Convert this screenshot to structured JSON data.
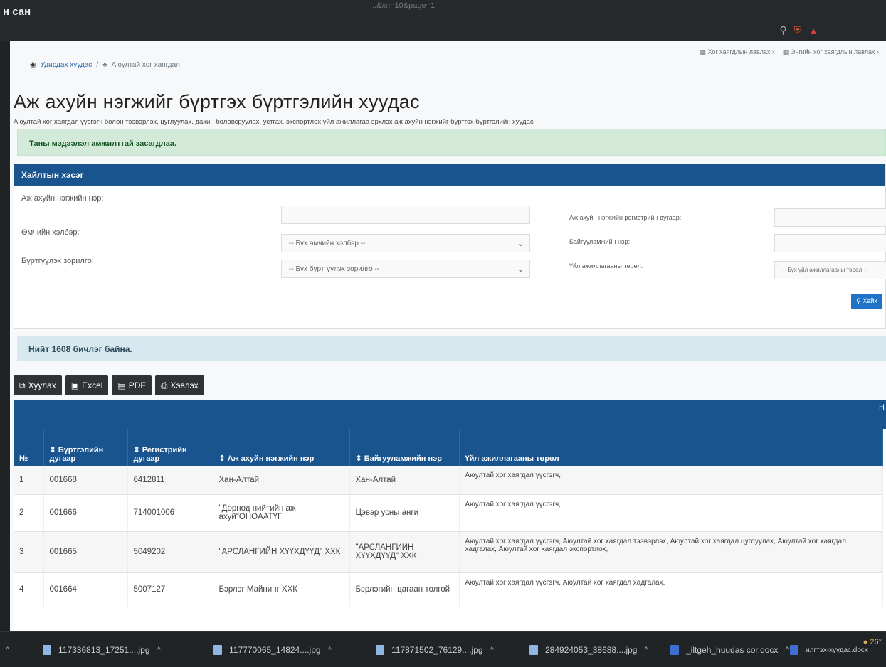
{
  "app_title": "н сан",
  "url_fragment": "...&xn=10&page=1",
  "top_links": [
    "Хог хаягдлын лавлах",
    "Энгийн хог хаягдлын лавлах"
  ],
  "breadcrumb": {
    "home": "Удирдах хуудас",
    "separator": "/",
    "current": "Аюултай хог хаягдал"
  },
  "page": {
    "title": "Аж ахуйн нэгжийг бүртгэх бүртгэлийн хуудас",
    "subtitle": "Аюултай хог хаягдал үүсгэгч болон тээвэрлэх, цуглуулах, дахин боловсруулах, устгах, экспортлох үйл ажиллагаа эрхлэх аж ахуйн нэгжийг бүртгэх бүртгэлийн хуудас"
  },
  "alert": "Таны мэдээлэл амжилттай засагдлаа.",
  "search": {
    "title": "Хайлтын хэсэг",
    "org_name_label": "Аж ахуйн нэгжийн нэр:",
    "org_name_value": "",
    "ownership_label": "Өмчийн хэлбэр:",
    "ownership_value": "-- Бүх өмчийн хэлбэр --",
    "purpose_label": "Бүртгүүлэх зорилго:",
    "purpose_value": "-- Бүх бүртгүүлэх зорилго --",
    "reg_no_label": "Аж ахуйн нэгжийн регистрийн дугаар:",
    "facility_label": "Байгууламжийн нэр:",
    "activity_label": "Үйл ажиллагааны төрөл:",
    "activity_value": "-- Бүх үйл ажиллагааны төрөл --",
    "search_button": "Хайх"
  },
  "records_info": "Нийт 1608 бичлэг байна.",
  "buttons": {
    "copy": "Хуулах",
    "excel": "Excel",
    "pdf": "PDF",
    "print": "Хэвлэх"
  },
  "table": {
    "edge_label": "Н",
    "headers": [
      "№",
      "⇕ Бүртгэлийн дугаар",
      "⇕ Регистрийн дугаар",
      "⇕ Аж ахуйн нэгжийн нэр",
      "⇕ Байгууламжийн нэр",
      "Үйл ажиллагааны төрөл"
    ],
    "rows": [
      [
        "1",
        "001668",
        "6412811",
        "Хан-Алтай",
        "Хан-Алтай",
        "Аюултай хог хаягдал үүсгэгч,"
      ],
      [
        "2",
        "001666",
        "714001006",
        "\"Дорнод нийтийн аж ахуй\"ОНӨААТҮГ",
        "Цэвэр усны анги",
        "Аюултай хог хаягдал үүсгэгч,"
      ],
      [
        "3",
        "001665",
        "5049202",
        "\"АРСЛАНГИЙН ХҮҮХДҮҮД\" ХХК",
        "\"АРСЛАНГИЙН ХҮҮХДҮҮД\" ХХК",
        "Аюултай хог хаягдал үүсгэгч, Аюултай хог хаягдал тээвэрлэх, Аюултай хог хаягдал цуглуулах, Аюултай хог хаягдал хадгалах, Аюултай хог хаягдал экспортлох,"
      ],
      [
        "4",
        "001664",
        "5007127",
        "Бэрлэг Майнинг ХХК",
        "Бэрлэгийн цагаан толгой",
        "Аюултай хог хаягдал үүсгэгч, Аюултай хог хаягдал хадгалах,"
      ]
    ]
  },
  "downloads": [
    "117336813_17251....jpg",
    "117770065_14824....jpg",
    "117871502_76129....jpg",
    "284924053_38688....jpg",
    "_iltgeh_huudas cor.docx",
    "илгтэх-хуудас.docx"
  ],
  "weather": "26°"
}
